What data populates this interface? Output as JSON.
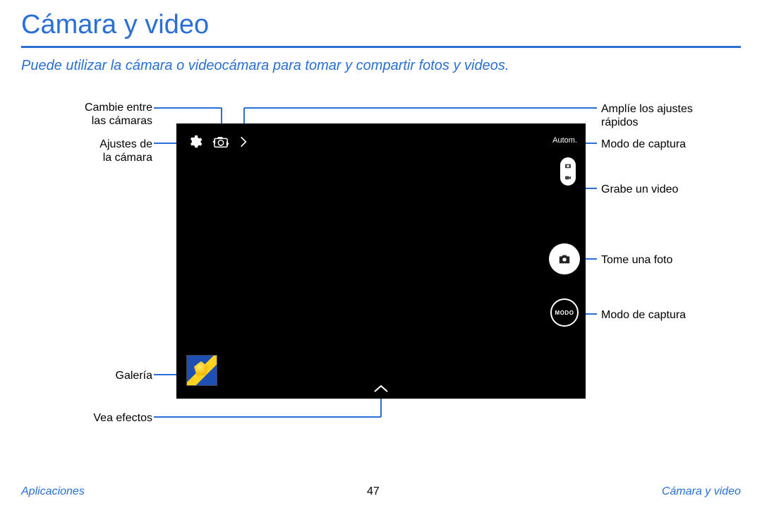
{
  "title": "Cámara y video",
  "subtitle": "Puede utilizar la cámara o videocámara para tomar y compartir fotos y videos.",
  "labels": {
    "switch_cameras": "Cambie entre\nlas cámaras",
    "camera_settings": "Ajustes de\nla cámara",
    "gallery": "Galería",
    "view_effects": "Vea efectos",
    "expand_quick": "Amplíe los ajustes\nrápidos",
    "capture_mode_top": "Modo de captura",
    "record_video": "Grabe un video",
    "take_photo": "Tome una foto",
    "capture_mode_bottom": "Modo de captura"
  },
  "camera_ui": {
    "auto_label": "Autom.",
    "modo_label": "MODO"
  },
  "footer": {
    "left": "Aplicaciones",
    "page": "47",
    "right": "Cámara y video"
  }
}
